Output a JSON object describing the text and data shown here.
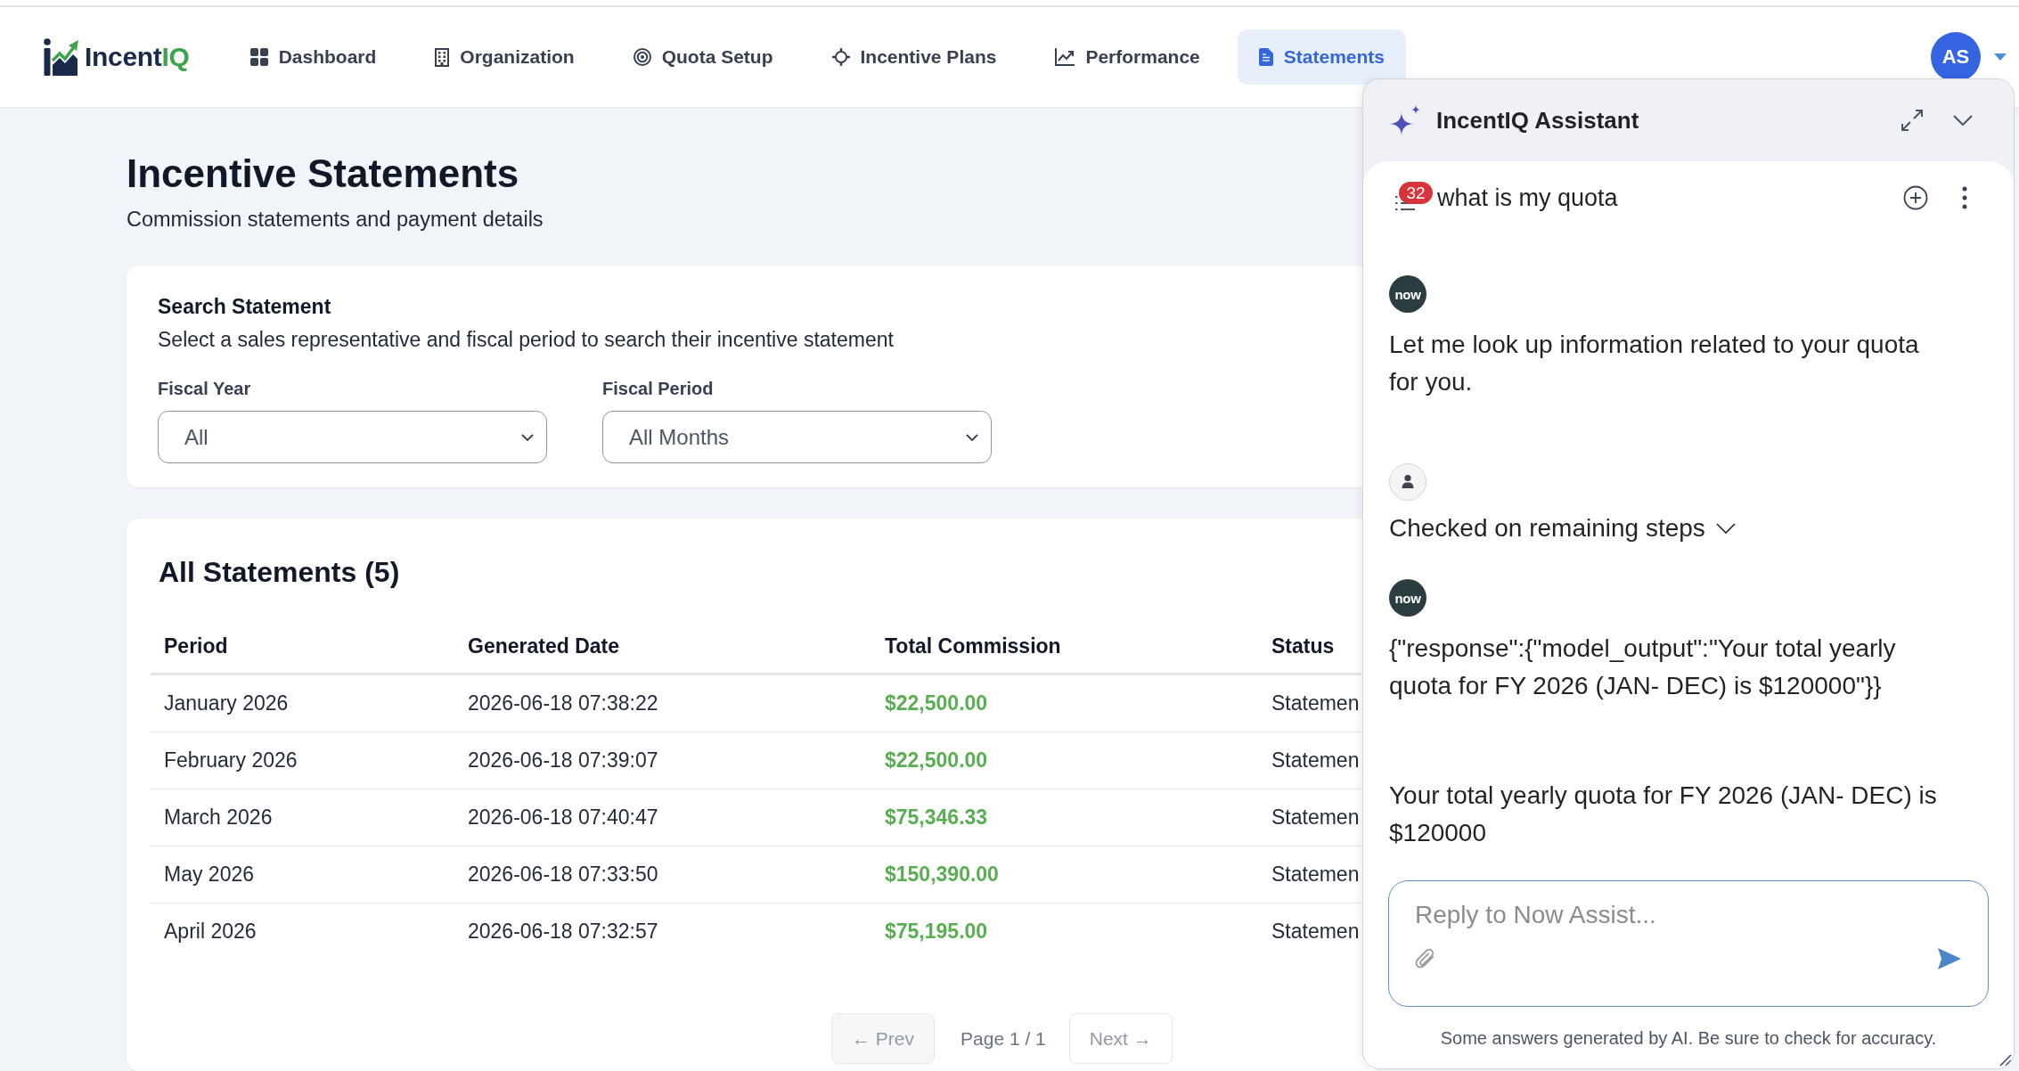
{
  "nav": {
    "logo": {
      "wordmark": [
        "Incent",
        "IQ"
      ]
    },
    "items": [
      {
        "label": "Dashboard",
        "selected": false
      },
      {
        "label": "Organization",
        "selected": false
      },
      {
        "label": "Quota Setup",
        "selected": false
      },
      {
        "label": "Incentive Plans",
        "selected": false
      },
      {
        "label": "Performance",
        "selected": false
      },
      {
        "label": "Statements",
        "selected": true
      }
    ],
    "user": {
      "initials": "AS"
    }
  },
  "page": {
    "title": "Incentive Statements",
    "subtitle": "Commission statements and payment details"
  },
  "search": {
    "title": "Search Statement",
    "description": "Select a sales representative and fiscal period to search their incentive statement",
    "fields": [
      {
        "label": "Fiscal Year",
        "value": "All"
      },
      {
        "label": "Fiscal Period",
        "value": "All Months"
      }
    ]
  },
  "statements": {
    "title": "All Statements (5)",
    "table": {
      "columns": [
        {
          "label": "Period",
          "kind": "text"
        },
        {
          "label": "Generated Date",
          "kind": "text"
        },
        {
          "label": "Total Commission",
          "kind": "money"
        },
        {
          "label": "Status",
          "kind": "text"
        }
      ],
      "rows": [
        {
          "cells": [
            "January 2026",
            "2026-06-18 07:38:22",
            "$22,500.00",
            "Statemen"
          ]
        },
        {
          "cells": [
            "February 2026",
            "2026-06-18 07:39:07",
            "$22,500.00",
            "Statemen"
          ]
        },
        {
          "cells": [
            "March 2026",
            "2026-06-18 07:40:47",
            "$75,346.33",
            "Statemen"
          ]
        },
        {
          "cells": [
            "May 2026",
            "2026-06-18 07:33:50",
            "$150,390.00",
            "Statemen"
          ]
        },
        {
          "cells": [
            "April 2026",
            "2026-06-18 07:32:57",
            "$75,195.00",
            "Statemen"
          ]
        }
      ]
    },
    "pagination": {
      "prev": {
        "label": "← Prev",
        "disabled": true
      },
      "page": "Page 1 / 1",
      "next": {
        "label": "Next →",
        "disabled": true
      }
    }
  },
  "assistant": {
    "title": "IncentIQ Assistant",
    "conversation": {
      "title": "what is my quota",
      "badge": "32"
    },
    "messages": [
      {
        "kind": "bot",
        "avatar": "now",
        "paragraphs": [
          "Let me look up information related to your quota for you."
        ]
      },
      {
        "kind": "steps",
        "label": "Checked on remaining steps",
        "expanded": false
      },
      {
        "kind": "bot",
        "avatar": "now",
        "paragraphs": [
          "{\"response\":{\"model_output\":\"Your total yearly quota for FY 2026 (JAN- DEC) is $120000\"}}",
          "Your total yearly quota for FY 2026 (JAN- DEC) is $120000"
        ]
      }
    ],
    "composer": {
      "placeholder": "Reply to Now Assist..."
    },
    "disclaimer": "Some answers generated by AI. Be sure to check for accuracy."
  }
}
